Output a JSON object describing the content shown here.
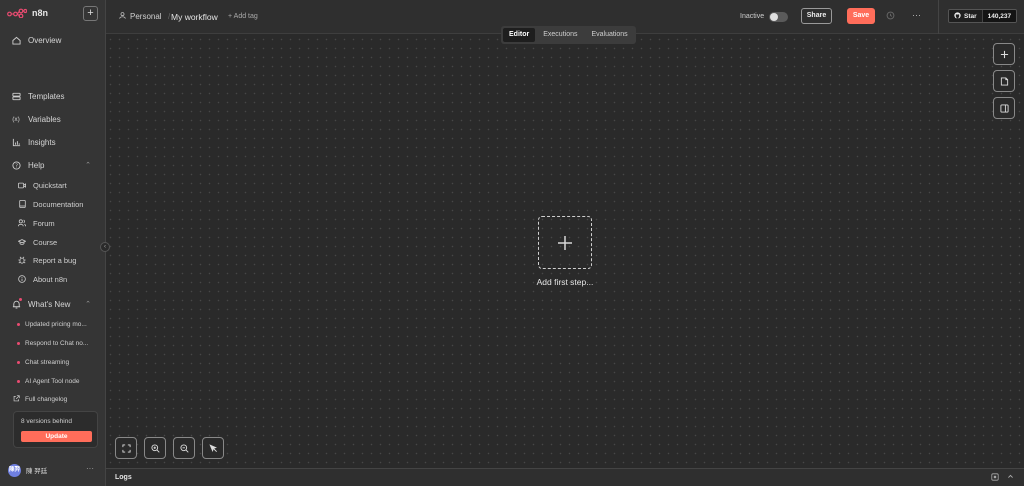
{
  "app": {
    "name": "n8n",
    "brand_color": "#ea4b71"
  },
  "sidebar": {
    "new_label": "+",
    "items": [
      {
        "label": "Overview",
        "icon": "home-icon"
      },
      {
        "label": "Templates",
        "icon": "templates-icon"
      },
      {
        "label": "Variables",
        "icon": "variables-icon"
      },
      {
        "label": "Insights",
        "icon": "insights-icon"
      },
      {
        "label": "Help",
        "icon": "help-icon"
      }
    ],
    "help_sub": [
      {
        "label": "Quickstart",
        "icon": "video-icon"
      },
      {
        "label": "Documentation",
        "icon": "book-icon"
      },
      {
        "label": "Forum",
        "icon": "users-icon"
      },
      {
        "label": "Course",
        "icon": "graduation-cap-icon"
      },
      {
        "label": "Report a bug",
        "icon": "bug-icon"
      },
      {
        "label": "About n8n",
        "icon": "info-icon"
      }
    ],
    "whats_new": {
      "label": "What's New",
      "items": [
        "Updated pricing mo...",
        "Respond to Chat no...",
        "Chat streaming",
        "AI Agent Tool node"
      ],
      "changelog": "Full changelog"
    },
    "update": {
      "text": "8 versions behind",
      "button": "Update"
    },
    "user": {
      "initials": "陳羿",
      "name": "陳 羿廷",
      "more": "···"
    }
  },
  "header": {
    "breadcrumb_project": "Personal",
    "breadcrumb_sep": "/",
    "workflow_name": "My workflow",
    "add_tag": "+ Add tag",
    "status_label": "Inactive",
    "share": "Share",
    "save": "Save",
    "more": "···",
    "github": {
      "star": "Star",
      "count": "140,237"
    }
  },
  "canvas": {
    "tabs": [
      {
        "label": "Editor",
        "active": true
      },
      {
        "label": "Executions",
        "active": false
      },
      {
        "label": "Evaluations",
        "active": false
      }
    ],
    "add_first": "Add first step..."
  },
  "logs": {
    "label": "Logs"
  },
  "colors": {
    "accent": "#ff6d5a",
    "background": "#2a2a2a",
    "sidebar": "#353535"
  }
}
